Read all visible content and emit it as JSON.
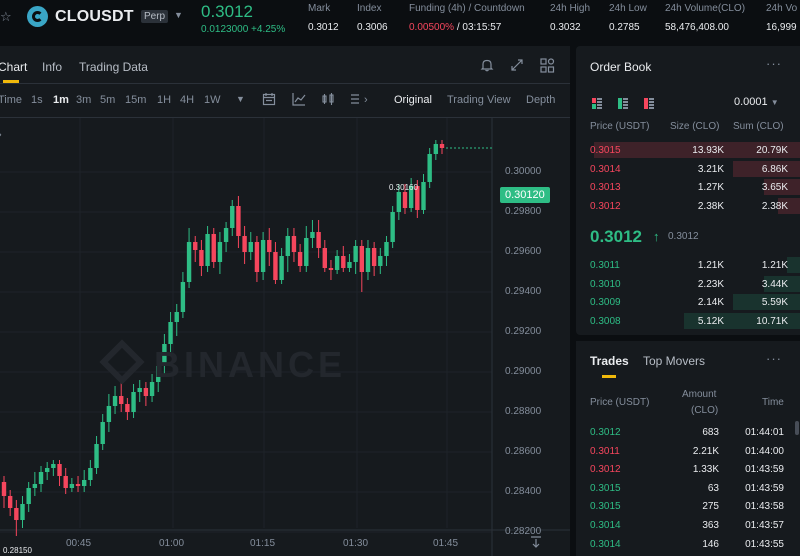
{
  "header": {
    "symbol": "CLOUSDT",
    "badge": "Perp",
    "last_price": "0.3012",
    "change": "0.0123000 +4.25%",
    "stats": [
      {
        "label": "Mark",
        "value": "0.3012"
      },
      {
        "label": "Index",
        "value": "0.3006"
      },
      {
        "label": "Funding (4h) / Countdown",
        "value_funding": "0.00500%",
        "value_countdown": "/ 03:15:57"
      },
      {
        "label": "24h High",
        "value": "0.3032"
      },
      {
        "label": "24h Low",
        "value": "0.2785"
      },
      {
        "label": "24h Volume(CLO)",
        "value": "58,476,408.00"
      },
      {
        "label": "24h Vo",
        "value": "16,999"
      }
    ]
  },
  "chart_panel": {
    "tabs": [
      "Chart",
      "Info",
      "Trading Data"
    ],
    "intervals": [
      "Time",
      "1s",
      "1m",
      "3m",
      "5m",
      "15m",
      "1H",
      "4H",
      "1W"
    ],
    "active_interval": "1m",
    "views": [
      "Original",
      "Trading View",
      "Depth"
    ],
    "active_view": "Original",
    "current_price_tag": "0.30120",
    "high_label": "0.30160",
    "low_label": "0.28150",
    "watermark": "BINANCE"
  },
  "chart_data": {
    "type": "candlestick",
    "y_ticks": [
      "0.30000",
      "0.29800",
      "0.29600",
      "0.29400",
      "0.29200",
      "0.29000",
      "0.28800",
      "0.28600",
      "0.28400",
      "0.28200"
    ],
    "x_ticks": [
      "00:45",
      "01:00",
      "01:15",
      "01:30",
      "01:45"
    ],
    "ylim": [
      0.2812,
      0.3022
    ],
    "candles": [
      [
        0.2845,
        0.2838,
        0.2848,
        0.2832
      ],
      [
        0.2838,
        0.2832,
        0.2841,
        0.2828
      ],
      [
        0.2832,
        0.2826,
        0.2836,
        0.2818
      ],
      [
        0.2826,
        0.2834,
        0.2838,
        0.2822
      ],
      [
        0.2834,
        0.2842,
        0.2845,
        0.283
      ],
      [
        0.2842,
        0.2844,
        0.285,
        0.2838
      ],
      [
        0.2844,
        0.285,
        0.2853,
        0.284
      ],
      [
        0.285,
        0.2852,
        0.2855,
        0.2846
      ],
      [
        0.2852,
        0.2854,
        0.2856,
        0.2848
      ],
      [
        0.2854,
        0.2848,
        0.2856,
        0.2843
      ],
      [
        0.2848,
        0.2842,
        0.2852,
        0.2839
      ],
      [
        0.2842,
        0.2844,
        0.2847,
        0.284
      ],
      [
        0.2844,
        0.2843,
        0.2848,
        0.284
      ],
      [
        0.2843,
        0.2846,
        0.2851,
        0.284
      ],
      [
        0.2846,
        0.2852,
        0.2856,
        0.2843
      ],
      [
        0.2852,
        0.2864,
        0.2868,
        0.2849
      ],
      [
        0.2864,
        0.2875,
        0.2879,
        0.2861
      ],
      [
        0.2875,
        0.2883,
        0.2889,
        0.287
      ],
      [
        0.2883,
        0.2888,
        0.2893,
        0.2879
      ],
      [
        0.2888,
        0.2884,
        0.2895,
        0.288
      ],
      [
        0.2884,
        0.288,
        0.2887,
        0.2876
      ],
      [
        0.288,
        0.289,
        0.2894,
        0.2877
      ],
      [
        0.289,
        0.2892,
        0.2896,
        0.2885
      ],
      [
        0.2892,
        0.2888,
        0.2895,
        0.2883
      ],
      [
        0.2888,
        0.2895,
        0.2899,
        0.2885
      ],
      [
        0.2895,
        0.2903,
        0.2906,
        0.289
      ],
      [
        0.2903,
        0.2914,
        0.2919,
        0.2899
      ],
      [
        0.2914,
        0.2925,
        0.293,
        0.291
      ],
      [
        0.2925,
        0.293,
        0.2934,
        0.2918
      ],
      [
        0.293,
        0.2945,
        0.295,
        0.2927
      ],
      [
        0.2945,
        0.2965,
        0.2972,
        0.2942
      ],
      [
        0.2965,
        0.2961,
        0.2968,
        0.2955
      ],
      [
        0.2961,
        0.2953,
        0.2966,
        0.2948
      ],
      [
        0.2953,
        0.2969,
        0.2973,
        0.295
      ],
      [
        0.2969,
        0.2955,
        0.2972,
        0.2952
      ],
      [
        0.2955,
        0.2965,
        0.297,
        0.2949
      ],
      [
        0.2965,
        0.2972,
        0.2975,
        0.296
      ],
      [
        0.2972,
        0.2983,
        0.2986,
        0.2968
      ],
      [
        0.2983,
        0.2968,
        0.2988,
        0.2962
      ],
      [
        0.2968,
        0.296,
        0.2973,
        0.2954
      ],
      [
        0.296,
        0.2965,
        0.297,
        0.2956
      ],
      [
        0.2965,
        0.295,
        0.2968,
        0.2945
      ],
      [
        0.295,
        0.2966,
        0.297,
        0.2946
      ],
      [
        0.2966,
        0.296,
        0.2972,
        0.2953
      ],
      [
        0.296,
        0.2946,
        0.2965,
        0.2944
      ],
      [
        0.2946,
        0.2958,
        0.2962,
        0.2944
      ],
      [
        0.2958,
        0.2968,
        0.2972,
        0.295
      ],
      [
        0.2968,
        0.296,
        0.2972,
        0.2955
      ],
      [
        0.296,
        0.2953,
        0.2964,
        0.295
      ],
      [
        0.2953,
        0.2967,
        0.2973,
        0.295
      ],
      [
        0.2967,
        0.297,
        0.2976,
        0.2962
      ],
      [
        0.297,
        0.2962,
        0.2976,
        0.2957
      ],
      [
        0.2962,
        0.2952,
        0.2966,
        0.295
      ],
      [
        0.2952,
        0.2951,
        0.2956,
        0.2946
      ],
      [
        0.2951,
        0.2958,
        0.2961,
        0.2949
      ],
      [
        0.2958,
        0.2952,
        0.2963,
        0.295
      ],
      [
        0.2952,
        0.2955,
        0.2959,
        0.295
      ],
      [
        0.2955,
        0.2963,
        0.2966,
        0.2949
      ],
      [
        0.2963,
        0.295,
        0.2966,
        0.294
      ],
      [
        0.295,
        0.2962,
        0.2966,
        0.2946
      ],
      [
        0.2962,
        0.2953,
        0.2965,
        0.2948
      ],
      [
        0.2953,
        0.2958,
        0.2962,
        0.2949
      ],
      [
        0.2958,
        0.2965,
        0.2968,
        0.2953
      ],
      [
        0.2965,
        0.298,
        0.2983,
        0.2962
      ],
      [
        0.298,
        0.299,
        0.2994,
        0.2976
      ],
      [
        0.299,
        0.2982,
        0.2994,
        0.2979
      ],
      [
        0.2982,
        0.2993,
        0.2997,
        0.298
      ],
      [
        0.2993,
        0.2981,
        0.2996,
        0.2977
      ],
      [
        0.2981,
        0.2995,
        0.2999,
        0.2979
      ],
      [
        0.2995,
        0.3009,
        0.3012,
        0.2992
      ],
      [
        0.3009,
        0.3014,
        0.3016,
        0.3006
      ],
      [
        0.3014,
        0.3012,
        0.3016,
        0.3009
      ]
    ]
  },
  "order_book": {
    "title": "Order Book",
    "tick": "0.0001",
    "headers": {
      "price": "Price (USDT)",
      "size": "Size (CLO)",
      "sum": "Sum (CLO)"
    },
    "asks": [
      {
        "price": "0.3015",
        "size": "13.93K",
        "sum": "20.79K",
        "depth": 0.92
      },
      {
        "price": "0.3014",
        "size": "3.21K",
        "sum": "6.86K",
        "depth": 0.3
      },
      {
        "price": "0.3013",
        "size": "1.27K",
        "sum": "3.65K",
        "depth": 0.16
      },
      {
        "price": "0.3012",
        "size": "2.38K",
        "sum": "2.38K",
        "depth": 0.1
      }
    ],
    "mid_price": "0.3012",
    "mid_mark": "0.3012",
    "bids": [
      {
        "price": "0.3011",
        "size": "1.21K",
        "sum": "1.21K",
        "depth": 0.06
      },
      {
        "price": "0.3010",
        "size": "2.23K",
        "sum": "3.44K",
        "depth": 0.16
      },
      {
        "price": "0.3009",
        "size": "2.14K",
        "sum": "5.59K",
        "depth": 0.3
      },
      {
        "price": "0.3008",
        "size": "5.12K",
        "sum": "10.71K",
        "depth": 0.52
      }
    ]
  },
  "trades": {
    "tabs": [
      "Trades",
      "Top Movers"
    ],
    "headers": {
      "price": "Price (USDT)",
      "amount_1": "Amount",
      "amount_2": "(CLO)",
      "time": "Time"
    },
    "rows": [
      {
        "price": "0.3012",
        "amount": "683",
        "time": "01:44:01",
        "side": "buy"
      },
      {
        "price": "0.3011",
        "amount": "2.21K",
        "time": "01:44:00",
        "side": "sell"
      },
      {
        "price": "0.3012",
        "amount": "1.33K",
        "time": "01:43:59",
        "side": "sell"
      },
      {
        "price": "0.3015",
        "amount": "63",
        "time": "01:43:59",
        "side": "buy"
      },
      {
        "price": "0.3015",
        "amount": "275",
        "time": "01:43:58",
        "side": "buy"
      },
      {
        "price": "0.3014",
        "amount": "363",
        "time": "01:43:57",
        "side": "buy"
      },
      {
        "price": "0.3014",
        "amount": "146",
        "time": "01:43:55",
        "side": "buy"
      }
    ]
  },
  "colors": {
    "up": "#2ebd85",
    "down": "#f6465d",
    "accent": "#f0b90b",
    "bg": "#0b0e11",
    "panel": "#161a1e"
  }
}
